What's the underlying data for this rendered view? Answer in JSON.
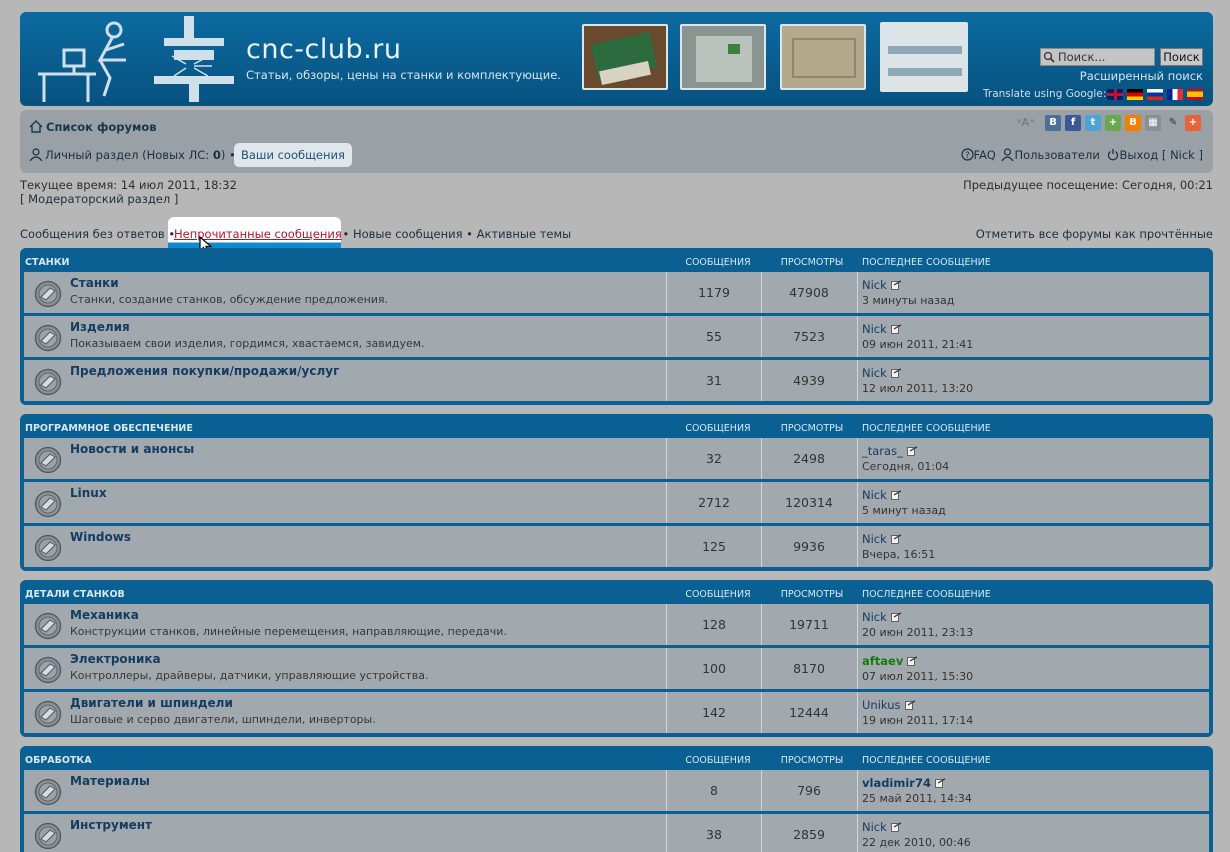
{
  "header": {
    "site_title": "cnc-club.ru",
    "site_desc": "Статьи, обзоры, цены на станки и комплектующие.",
    "search_placeholder": "Поиск...",
    "search_button": "Поиск",
    "advanced_search": "Расширенный поиск",
    "translate_label": "Translate using Google:",
    "flags": [
      "en",
      "de",
      "ru",
      "fr",
      "es"
    ]
  },
  "nav": {
    "home": "Список форумов",
    "font_size": "ᵛA⁺",
    "personal": "Личный раздел",
    "new_pm_prefix": "(Новых ЛС: ",
    "new_pm_count": "0",
    "new_pm_suffix": ")",
    "your_posts": "Ваши сообщения",
    "faq": "FAQ",
    "users": "Пользователи",
    "logout": "Выход",
    "username": "Nick"
  },
  "info": {
    "current_time": "Текущее время: 14 июл 2011, 18:32",
    "moderator": "Модераторский раздел",
    "prev_visit": "Предыдущее посещение: Сегодня, 00:21"
  },
  "quick_links": {
    "unanswered": "Сообщения без ответов",
    "unread": "Непрочитанные сообщения",
    "new_posts": "Новые сообщения",
    "active": "Активные темы",
    "mark_read": "Отметить все форумы как прочтённые"
  },
  "columns": {
    "posts": "Сообщения",
    "views": "Просмотры",
    "last": "Последнее сообщение"
  },
  "categories": [
    {
      "name": "Станки",
      "forums": [
        {
          "title": "Станки",
          "desc": "Станки, создание станков, обсуждение предложения.",
          "posts": "1179",
          "views": "47908",
          "user": "Nick",
          "date": "3 минуты назад",
          "style": ""
        },
        {
          "title": "Изделия",
          "desc": "Показываем свои изделия, гордимся, хвастаемся, завидуем.",
          "posts": "55",
          "views": "7523",
          "user": "Nick",
          "date": "09 июн 2011, 21:41",
          "style": ""
        },
        {
          "title": "Предложения покупки/продажи/услуг",
          "desc": "",
          "posts": "31",
          "views": "4939",
          "user": "Nick",
          "date": "12 июл 2011, 13:20",
          "style": ""
        }
      ]
    },
    {
      "name": "Программное обеспечение",
      "forums": [
        {
          "title": "Новости и анонсы",
          "desc": "",
          "posts": "32",
          "views": "2498",
          "user": "_taras_",
          "date": "Сегодня, 01:04",
          "style": ""
        },
        {
          "title": "Linux",
          "desc": "",
          "posts": "2712",
          "views": "120314",
          "user": "Nick",
          "date": "5 минут назад",
          "style": ""
        },
        {
          "title": "Windows",
          "desc": "",
          "posts": "125",
          "views": "9936",
          "user": "Nick",
          "date": "Вчера, 16:51",
          "style": ""
        }
      ]
    },
    {
      "name": "Детали станков",
      "forums": [
        {
          "title": "Механика",
          "desc": "Конструкции станков, линейные перемещения, направляющие, передачи.",
          "posts": "128",
          "views": "19711",
          "user": "Nick",
          "date": "20 июн 2011, 23:13",
          "style": ""
        },
        {
          "title": "Электроника",
          "desc": "Контроллеры, драйверы, датчики, управляющие устройства.",
          "posts": "100",
          "views": "8170",
          "user": "aftaev",
          "date": "07 июл 2011, 15:30",
          "style": "green"
        },
        {
          "title": "Двигатели и шпиндели",
          "desc": "Шаговые и серво двигатели, шпиндели, инверторы.",
          "posts": "142",
          "views": "12444",
          "user": "Unikus",
          "date": "19 июн 2011, 17:14",
          "style": ""
        }
      ]
    },
    {
      "name": "Обработка",
      "forums": [
        {
          "title": "Материалы",
          "desc": "",
          "posts": "8",
          "views": "796",
          "user": "vladimir74",
          "date": "25 май 2011, 14:34",
          "style": "bold"
        },
        {
          "title": "Инструмент",
          "desc": "",
          "posts": "38",
          "views": "2859",
          "user": "Nick",
          "date": "22 дек 2010, 00:46",
          "style": ""
        }
      ]
    }
  ],
  "colors": {
    "header_bg": "#0a5f93",
    "row_bg": "#a2a9ae",
    "link": "#153c62",
    "unread_link": "#b0152e",
    "green_user": "#137c0c"
  }
}
